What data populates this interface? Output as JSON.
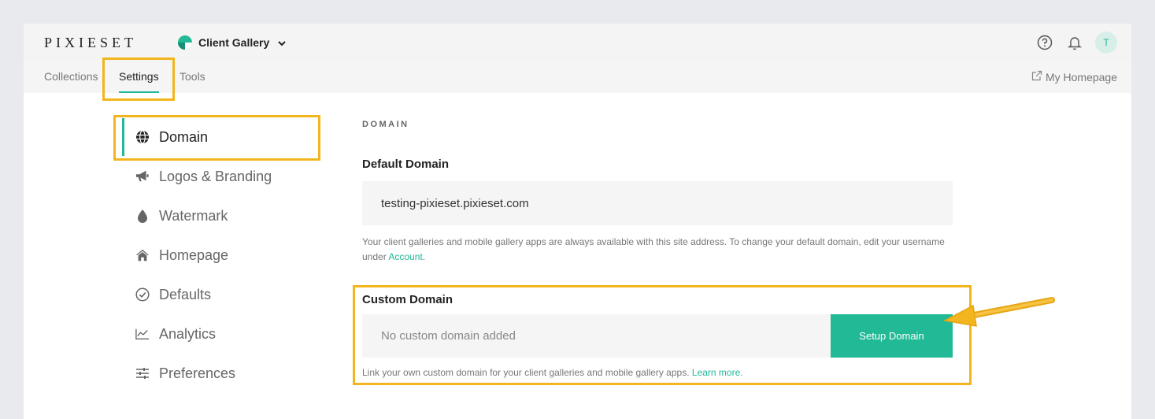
{
  "app": {
    "logo": "PIXIESET",
    "product": "Client Gallery",
    "avatar_initial": "T"
  },
  "subnav": {
    "tabs": [
      {
        "label": "Collections"
      },
      {
        "label": "Settings"
      },
      {
        "label": "Tools"
      }
    ],
    "right_link": "My Homepage"
  },
  "sidebar": {
    "items": [
      {
        "label": "Domain",
        "icon": "globe-icon"
      },
      {
        "label": "Logos & Branding",
        "icon": "megaphone-icon"
      },
      {
        "label": "Watermark",
        "icon": "drop-icon"
      },
      {
        "label": "Homepage",
        "icon": "home-icon"
      },
      {
        "label": "Defaults",
        "icon": "check-circle-icon"
      },
      {
        "label": "Analytics",
        "icon": "chart-icon"
      },
      {
        "label": "Preferences",
        "icon": "sliders-icon"
      }
    ]
  },
  "main": {
    "section_label": "DOMAIN",
    "default_domain": {
      "title": "Default Domain",
      "value": "testing-pixieset.pixieset.com",
      "help_text": "Your client galleries and mobile gallery apps are always available with this site address. To change your default domain, edit your username under",
      "help_link": "Account",
      "help_end": "."
    },
    "custom_domain": {
      "title": "Custom Domain",
      "placeholder": "No custom domain added",
      "button": "Setup Domain",
      "help_text": "Link your own custom domain for your client galleries and mobile gallery apps.",
      "help_link": "Learn more."
    }
  },
  "colors": {
    "accent": "#21b996",
    "highlight": "#f3b51d"
  }
}
